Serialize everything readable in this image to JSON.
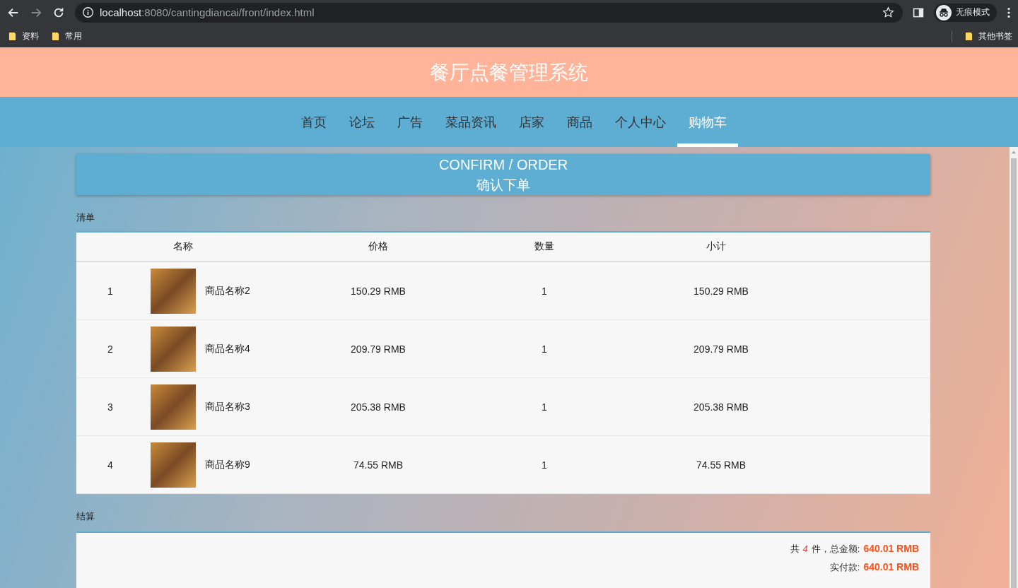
{
  "browser": {
    "url_host": "localhost",
    "url_path": ":8080/cantingdiancai/front/index.html",
    "profile": "无痕模式",
    "bookmarks": [
      {
        "label": "资料"
      },
      {
        "label": "常用"
      }
    ],
    "other_bookmarks": "其他书签"
  },
  "site_title": "餐厅点餐管理系统",
  "nav": [
    {
      "label": "首页",
      "selected": false
    },
    {
      "label": "论坛",
      "selected": false
    },
    {
      "label": "广告",
      "selected": false
    },
    {
      "label": "菜品资讯",
      "selected": false
    },
    {
      "label": "店家",
      "selected": false
    },
    {
      "label": "商品",
      "selected": false
    },
    {
      "label": "个人中心",
      "selected": false
    },
    {
      "label": "购物车",
      "selected": true
    }
  ],
  "banner": {
    "title": "CONFIRM / ORDER",
    "subtitle": "确认下单"
  },
  "list_label": "清单",
  "table": {
    "columns": [
      "名称",
      "价格",
      "数量",
      "小计"
    ],
    "rows": [
      {
        "index": "1",
        "name": "商品名称2",
        "price": "150.29 RMB",
        "quantity": "1",
        "subtotal": "150.29 RMB"
      },
      {
        "index": "2",
        "name": "商品名称4",
        "price": "209.79 RMB",
        "quantity": "1",
        "subtotal": "209.79 RMB"
      },
      {
        "index": "3",
        "name": "商品名称3",
        "price": "205.38 RMB",
        "quantity": "1",
        "subtotal": "205.38 RMB"
      },
      {
        "index": "4",
        "name": "商品名称9",
        "price": "74.55 RMB",
        "quantity": "1",
        "subtotal": "74.55 RMB"
      }
    ]
  },
  "settle_label": "结算",
  "summary": {
    "prefix": "共",
    "count": "4",
    "count_suffix": "件，总金额:",
    "total": "640.01 RMB",
    "paid_label": "实付款:",
    "paid": "640.01 RMB"
  }
}
